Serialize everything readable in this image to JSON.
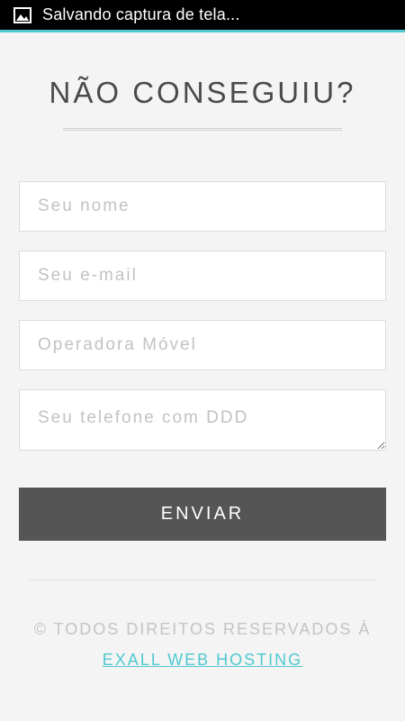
{
  "status_bar": {
    "icon": "image-icon",
    "text": "Salvando captura de tela..."
  },
  "form": {
    "title": "NÃO CONSEGUIU?",
    "fields": {
      "name_placeholder": "Seu nome",
      "email_placeholder": "Seu e-mail",
      "operator_placeholder": "Operadora Móvel",
      "phone_placeholder": "Seu telefone com DDD"
    },
    "submit_label": "ENVIAR"
  },
  "footer": {
    "copyright": "© TODOS DIREITOS RESERVADOS À",
    "company_link": "EXALL WEB HOSTING"
  },
  "colors": {
    "accent": "#4fc8cf",
    "button_bg": "#555555",
    "background": "#f4f4f4",
    "status_bar": "#000000"
  }
}
